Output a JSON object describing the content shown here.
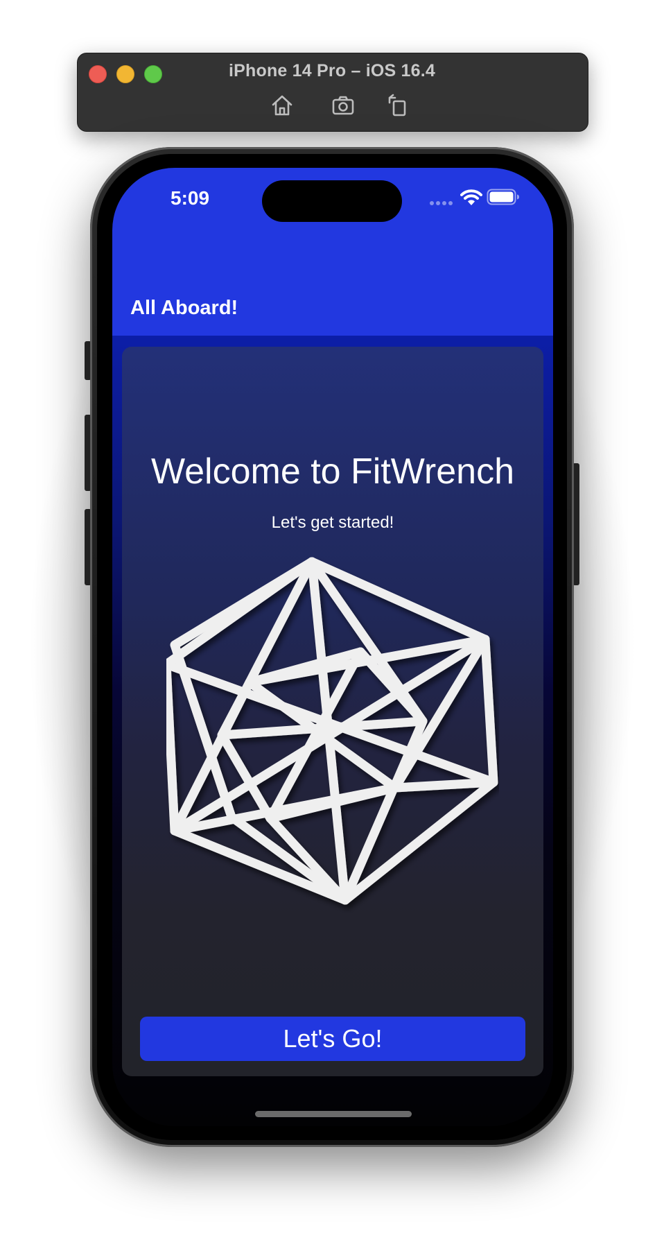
{
  "simulator": {
    "title": "iPhone 14 Pro – iOS 16.4",
    "toolbar_icons": [
      "home-icon",
      "screenshot-icon",
      "rotate-icon"
    ]
  },
  "status_bar": {
    "time": "5:09",
    "icons": [
      "cellular-icon",
      "wifi-icon",
      "battery-icon"
    ]
  },
  "nav": {
    "title": "All Aboard!"
  },
  "onboarding": {
    "heading": "Welcome to FitWrench",
    "subheading": "Let's get started!",
    "logo_icon": "hypercube-logo-icon",
    "cta_label": "Let's Go!"
  },
  "colors": {
    "accent": "#2238e0",
    "header": "#2238e0",
    "card_top": "#233078",
    "card_bottom": "#22232a",
    "text": "#ffffff",
    "logo_stroke": "#efefef"
  }
}
